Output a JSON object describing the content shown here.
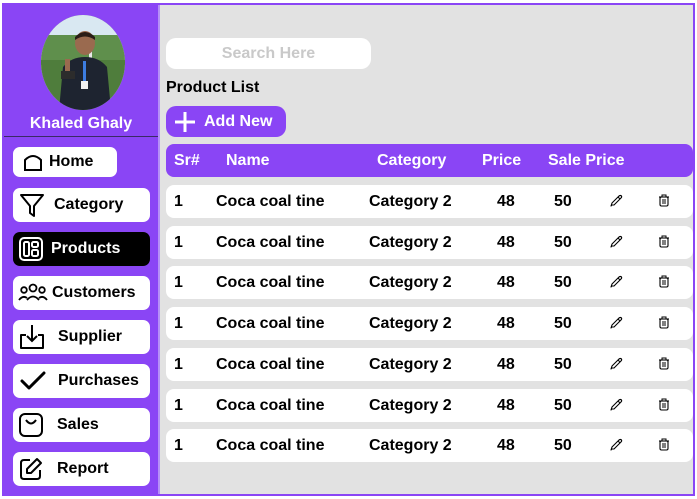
{
  "user": {
    "name": "Khaled Ghaly"
  },
  "sidebar": {
    "items": [
      {
        "label": "Home",
        "icon": "home-icon",
        "active": false
      },
      {
        "label": "Category",
        "icon": "filter-icon",
        "active": false
      },
      {
        "label": "Products",
        "icon": "grid-icon",
        "active": true
      },
      {
        "label": "Customers",
        "icon": "users-icon",
        "active": false
      },
      {
        "label": "Supplier",
        "icon": "download-icon",
        "active": false
      },
      {
        "label": "Purchases",
        "icon": "check-icon",
        "active": false
      },
      {
        "label": "Sales",
        "icon": "bag-icon",
        "active": false
      },
      {
        "label": "Report",
        "icon": "edit-icon",
        "active": false
      }
    ]
  },
  "search": {
    "placeholder": "Search Here"
  },
  "page": {
    "title": "Product List",
    "add_label": "Add New"
  },
  "table": {
    "headers": [
      "Sr#",
      "Name",
      "Category",
      "Price",
      "Sale Price"
    ],
    "rows": [
      {
        "sr": "1",
        "name": "Coca coal tine",
        "category": "Category 2",
        "price": "48",
        "sale": "50"
      },
      {
        "sr": "1",
        "name": "Coca coal tine",
        "category": "Category 2",
        "price": "48",
        "sale": "50"
      },
      {
        "sr": "1",
        "name": "Coca coal tine",
        "category": "Category 2",
        "price": "48",
        "sale": "50"
      },
      {
        "sr": "1",
        "name": "Coca coal tine",
        "category": "Category 2",
        "price": "48",
        "sale": "50"
      },
      {
        "sr": "1",
        "name": "Coca coal tine",
        "category": "Category 2",
        "price": "48",
        "sale": "50"
      },
      {
        "sr": "1",
        "name": "Coca coal tine",
        "category": "Category 2",
        "price": "48",
        "sale": "50"
      },
      {
        "sr": "1",
        "name": "Coca coal tine",
        "category": "Category 2",
        "price": "48",
        "sale": "50"
      }
    ]
  },
  "colors": {
    "accent": "#8a45f5",
    "background": "#e2e2e2",
    "active_nav": "#000000"
  }
}
